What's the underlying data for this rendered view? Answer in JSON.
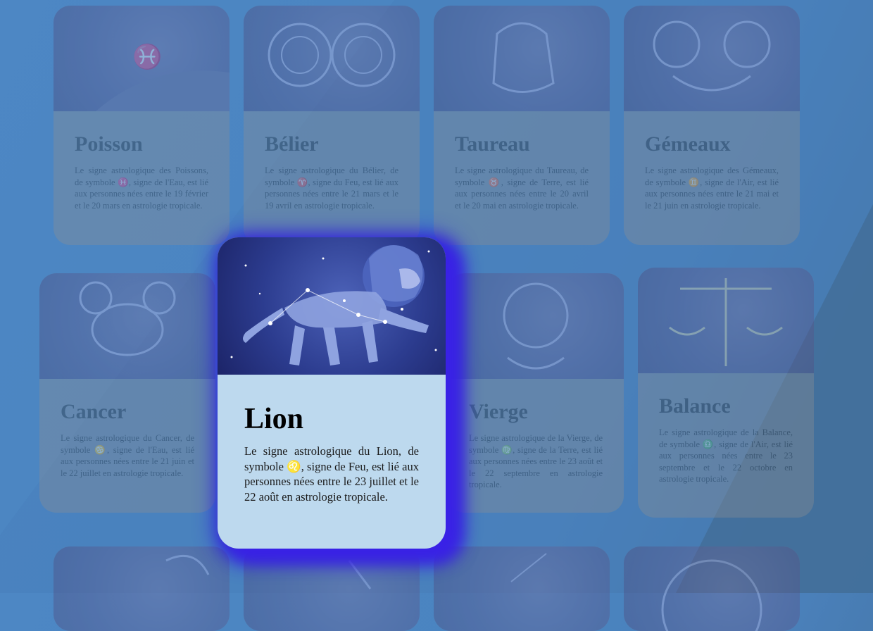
{
  "cards": [
    {
      "id": "poisson",
      "title": "Poisson",
      "text": "Le signe astrologique des Poissons, de symbole ♓, signe de l'Eau, est lié aux personnes nées entre le 19 février et le 20 mars en astrologie tropicale."
    },
    {
      "id": "belier",
      "title": "Bélier",
      "text": "Le signe astrologique du Bélier, de symbole ♈, signe du Feu, est lié aux personnes nées entre le 21 mars et le 19 avril en astrologie tropicale."
    },
    {
      "id": "taureau",
      "title": "Taureau",
      "text": "Le signe astrologique du Taureau, de symbole ♉, signe de Terre, est lié aux personnes nées entre le 20 avril et le 20 mai en astrologie tropicale."
    },
    {
      "id": "gemeaux",
      "title": "Gémeaux",
      "text": "Le signe astrologique des Gémeaux, de symbole ♊, signe de l'Air, est lié aux personnes nées entre le 21 mai et le 21 juin en astrologie tropicale."
    },
    {
      "id": "cancer",
      "title": "Cancer",
      "text": "Le signe astrologique du Cancer, de symbole ♋, signe de l'Eau, est lié aux personnes nées entre le 21 juin et le 22 juillet en astrologie tropicale."
    },
    {
      "id": "vierge",
      "title": "Vierge",
      "text": "Le signe astrologique de la Vierge, de symbole ♍, signe de la Terre, est lié aux personnes nées entre le 23 août et le 22 septembre en astrologie tropicale."
    },
    {
      "id": "balance",
      "title": "Balance",
      "text": "Le signe astrologique de la Balance, de symbole ♎, signe de l'Air, est lié aux personnes nées entre le 23 septembre et le 22 octobre en astrologie tropicale."
    }
  ],
  "active_card": {
    "title": "Lion",
    "text": "Le signe astrologique du Lion, de symbole ♌, signe de Feu, est lié aux personnes nées entre le 23 juillet et le 22 août en astrologie tropicale."
  },
  "colors": {
    "background": "#4a84c0",
    "active_card_bg": "#bdd9ee",
    "active_glow": "#3a22e6"
  }
}
